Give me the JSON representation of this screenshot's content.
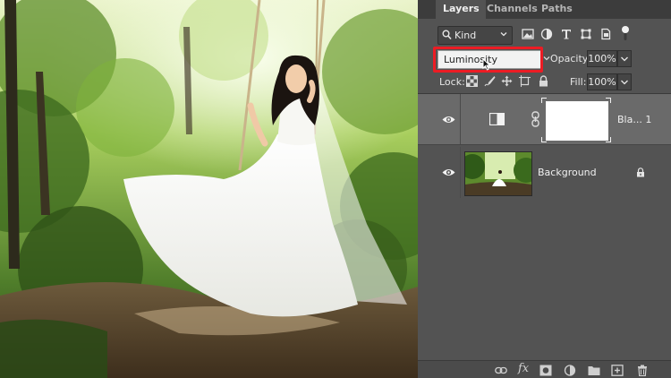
{
  "panel": {
    "tabs": [
      {
        "label": "Layers",
        "active": true
      },
      {
        "label": "Channels",
        "active": false
      },
      {
        "label": "Paths",
        "active": false
      }
    ],
    "filter": {
      "kind_label": "Kind",
      "icons": [
        "image-filter-icon",
        "adjustment-filter-icon",
        "type-filter-icon",
        "shape-filter-icon",
        "smart-object-filter-icon",
        "filter-toggle-icon"
      ]
    },
    "blend_mode": "Luminosity",
    "opacity_label": "Opacity:",
    "opacity_value": "100%",
    "lock_label": "Lock:",
    "lock_icons": [
      "lock-transparent-pixels-icon",
      "lock-image-pixels-icon",
      "lock-position-icon",
      "lock-artboard-icon",
      "lock-all-icon"
    ],
    "fill_label": "Fill:",
    "fill_value": "100%",
    "layers": [
      {
        "name": "Bla... 1",
        "type": "black-white-adjustment",
        "selected": true,
        "visible": true
      },
      {
        "name": "Background",
        "type": "pixel",
        "selected": false,
        "visible": true,
        "locked": true
      }
    ],
    "bottom_icons": [
      "link-layers-icon",
      "fx-icon",
      "add-mask-icon",
      "new-adjustment-icon",
      "new-group-icon",
      "new-layer-icon",
      "trash-icon"
    ]
  },
  "colors": {
    "panel_bg": "#535353",
    "tabbar_bg": "#3c3c3c",
    "selected_row": "#6a6a6a",
    "highlight": "#ec1c24"
  }
}
